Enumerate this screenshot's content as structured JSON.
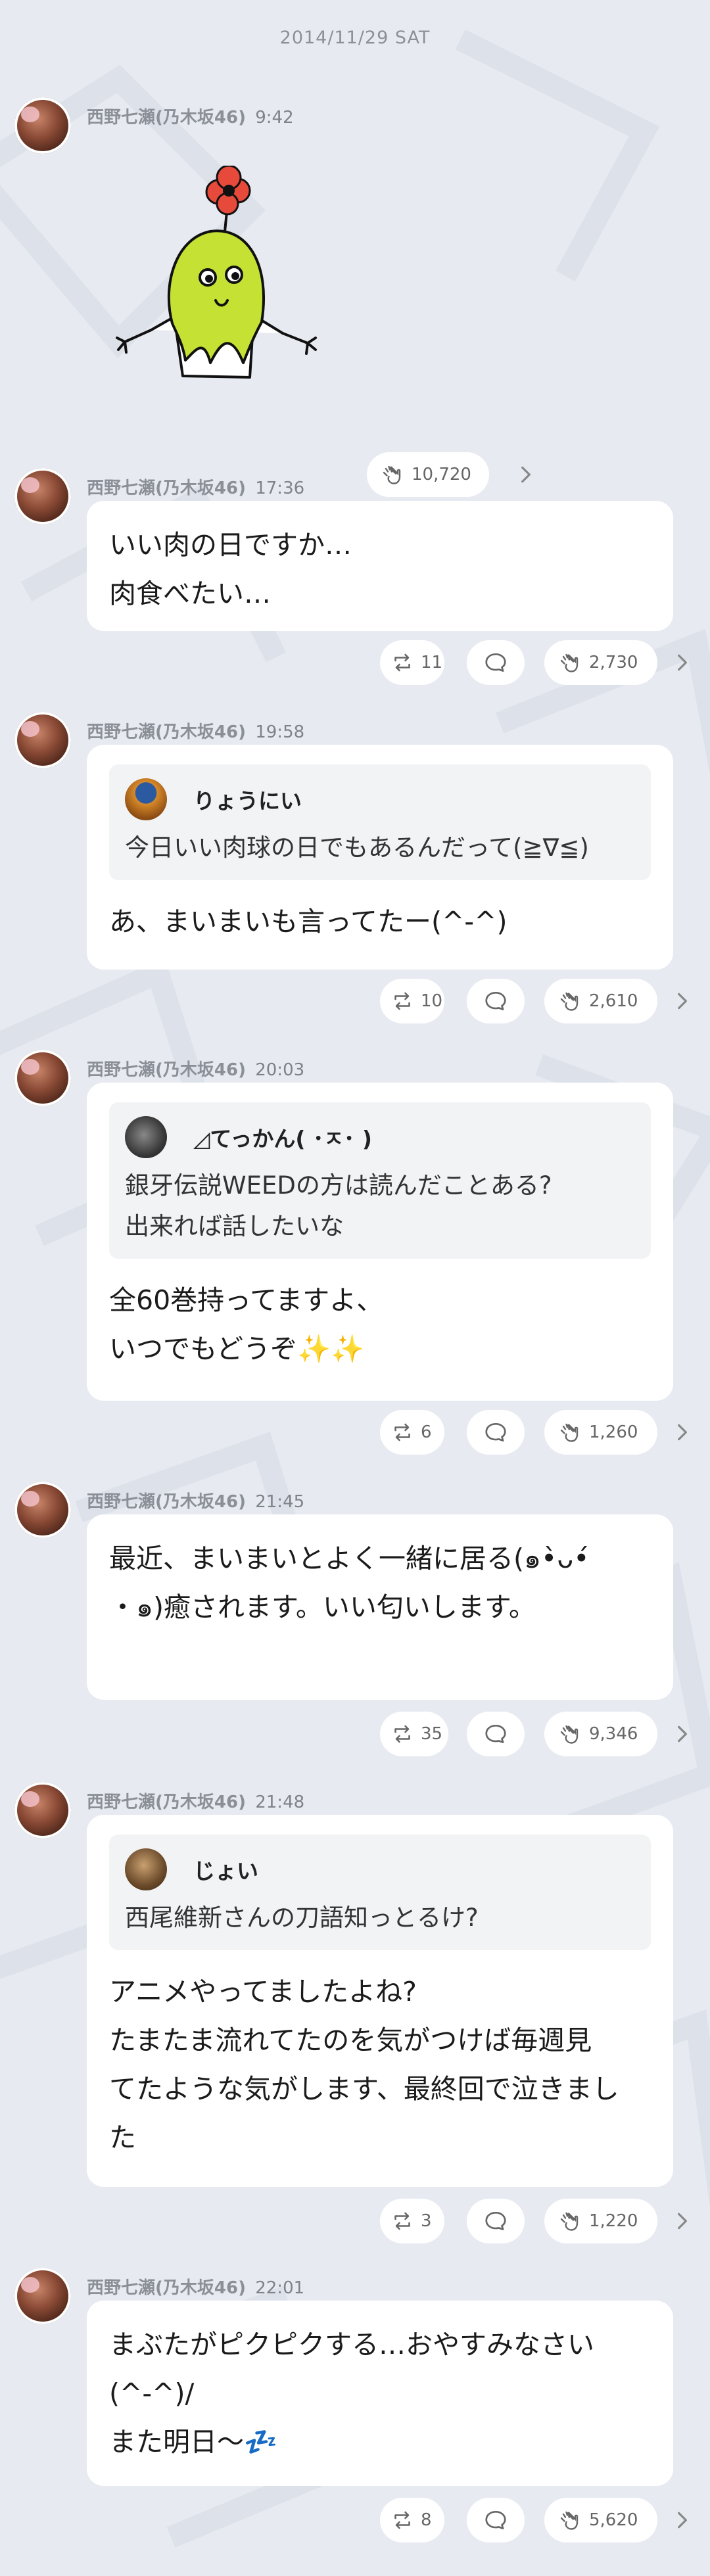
{
  "date": "2014/11/29 SAT",
  "author": "西野七瀬(乃木坂46)",
  "sticker_post": {
    "time": "9:42",
    "claps": "10,720"
  },
  "posts": [
    {
      "time": "17:36",
      "text": "いい肉の日ですか…\n肉食べたい…",
      "reposts": "11",
      "claps": "2,730"
    },
    {
      "time": "19:58",
      "quote": {
        "name": "りょうにい",
        "text": "今日いい肉球の日でもあるんだって(≧∇≦)"
      },
      "text": "あ、まいまいも言ってたー(^-^)",
      "reposts": "10",
      "claps": "2,610"
    },
    {
      "time": "20:03",
      "quote": {
        "name": "◿てっかん( ･ㅈ･ )",
        "text": "銀牙伝説WEEDの方は読んだことある?\n出来れば話したいな"
      },
      "text": "全60巻持ってますよ、\nいつでもどうぞ✨✨",
      "reposts": "6",
      "claps": "1,260"
    },
    {
      "time": "21:45",
      "text": "最近、まいまいとよく一緒に居る(๑•̀ᴗ•́\n・๑)癒されます。いい匂いします。",
      "reposts": "35",
      "claps": "9,346"
    },
    {
      "time": "21:48",
      "quote": {
        "name": "じょい",
        "text": "西尾維新さんの刀語知っとるけ?"
      },
      "text": "アニメやってましたよね?\nたまたま流れてたのを気がつけば毎週見\nてたような気がします、最終回で泣きまし\nた",
      "reposts": "3",
      "claps": "1,220"
    },
    {
      "time": "22:01",
      "text": "まぶたがピクピクする…おやすみなさい\n(^-^)/\nまた明日〜💤",
      "reposts": "8",
      "claps": "5,620"
    }
  ]
}
